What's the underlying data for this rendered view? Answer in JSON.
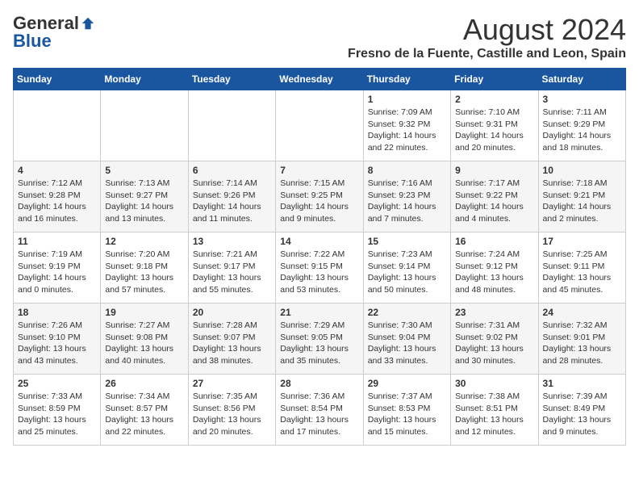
{
  "header": {
    "logo_general": "General",
    "logo_blue": "Blue",
    "month_title": "August 2024",
    "location": "Fresno de la Fuente, Castille and Leon, Spain"
  },
  "weekdays": [
    "Sunday",
    "Monday",
    "Tuesday",
    "Wednesday",
    "Thursday",
    "Friday",
    "Saturday"
  ],
  "weeks": [
    [
      {
        "day": "",
        "sunrise": "",
        "sunset": "",
        "daylight": ""
      },
      {
        "day": "",
        "sunrise": "",
        "sunset": "",
        "daylight": ""
      },
      {
        "day": "",
        "sunrise": "",
        "sunset": "",
        "daylight": ""
      },
      {
        "day": "",
        "sunrise": "",
        "sunset": "",
        "daylight": ""
      },
      {
        "day": "1",
        "sunrise": "Sunrise: 7:09 AM",
        "sunset": "Sunset: 9:32 PM",
        "daylight": "Daylight: 14 hours and 22 minutes."
      },
      {
        "day": "2",
        "sunrise": "Sunrise: 7:10 AM",
        "sunset": "Sunset: 9:31 PM",
        "daylight": "Daylight: 14 hours and 20 minutes."
      },
      {
        "day": "3",
        "sunrise": "Sunrise: 7:11 AM",
        "sunset": "Sunset: 9:29 PM",
        "daylight": "Daylight: 14 hours and 18 minutes."
      }
    ],
    [
      {
        "day": "4",
        "sunrise": "Sunrise: 7:12 AM",
        "sunset": "Sunset: 9:28 PM",
        "daylight": "Daylight: 14 hours and 16 minutes."
      },
      {
        "day": "5",
        "sunrise": "Sunrise: 7:13 AM",
        "sunset": "Sunset: 9:27 PM",
        "daylight": "Daylight: 14 hours and 13 minutes."
      },
      {
        "day": "6",
        "sunrise": "Sunrise: 7:14 AM",
        "sunset": "Sunset: 9:26 PM",
        "daylight": "Daylight: 14 hours and 11 minutes."
      },
      {
        "day": "7",
        "sunrise": "Sunrise: 7:15 AM",
        "sunset": "Sunset: 9:25 PM",
        "daylight": "Daylight: 14 hours and 9 minutes."
      },
      {
        "day": "8",
        "sunrise": "Sunrise: 7:16 AM",
        "sunset": "Sunset: 9:23 PM",
        "daylight": "Daylight: 14 hours and 7 minutes."
      },
      {
        "day": "9",
        "sunrise": "Sunrise: 7:17 AM",
        "sunset": "Sunset: 9:22 PM",
        "daylight": "Daylight: 14 hours and 4 minutes."
      },
      {
        "day": "10",
        "sunrise": "Sunrise: 7:18 AM",
        "sunset": "Sunset: 9:21 PM",
        "daylight": "Daylight: 14 hours and 2 minutes."
      }
    ],
    [
      {
        "day": "11",
        "sunrise": "Sunrise: 7:19 AM",
        "sunset": "Sunset: 9:19 PM",
        "daylight": "Daylight: 14 hours and 0 minutes."
      },
      {
        "day": "12",
        "sunrise": "Sunrise: 7:20 AM",
        "sunset": "Sunset: 9:18 PM",
        "daylight": "Daylight: 13 hours and 57 minutes."
      },
      {
        "day": "13",
        "sunrise": "Sunrise: 7:21 AM",
        "sunset": "Sunset: 9:17 PM",
        "daylight": "Daylight: 13 hours and 55 minutes."
      },
      {
        "day": "14",
        "sunrise": "Sunrise: 7:22 AM",
        "sunset": "Sunset: 9:15 PM",
        "daylight": "Daylight: 13 hours and 53 minutes."
      },
      {
        "day": "15",
        "sunrise": "Sunrise: 7:23 AM",
        "sunset": "Sunset: 9:14 PM",
        "daylight": "Daylight: 13 hours and 50 minutes."
      },
      {
        "day": "16",
        "sunrise": "Sunrise: 7:24 AM",
        "sunset": "Sunset: 9:12 PM",
        "daylight": "Daylight: 13 hours and 48 minutes."
      },
      {
        "day": "17",
        "sunrise": "Sunrise: 7:25 AM",
        "sunset": "Sunset: 9:11 PM",
        "daylight": "Daylight: 13 hours and 45 minutes."
      }
    ],
    [
      {
        "day": "18",
        "sunrise": "Sunrise: 7:26 AM",
        "sunset": "Sunset: 9:10 PM",
        "daylight": "Daylight: 13 hours and 43 minutes."
      },
      {
        "day": "19",
        "sunrise": "Sunrise: 7:27 AM",
        "sunset": "Sunset: 9:08 PM",
        "daylight": "Daylight: 13 hours and 40 minutes."
      },
      {
        "day": "20",
        "sunrise": "Sunrise: 7:28 AM",
        "sunset": "Sunset: 9:07 PM",
        "daylight": "Daylight: 13 hours and 38 minutes."
      },
      {
        "day": "21",
        "sunrise": "Sunrise: 7:29 AM",
        "sunset": "Sunset: 9:05 PM",
        "daylight": "Daylight: 13 hours and 35 minutes."
      },
      {
        "day": "22",
        "sunrise": "Sunrise: 7:30 AM",
        "sunset": "Sunset: 9:04 PM",
        "daylight": "Daylight: 13 hours and 33 minutes."
      },
      {
        "day": "23",
        "sunrise": "Sunrise: 7:31 AM",
        "sunset": "Sunset: 9:02 PM",
        "daylight": "Daylight: 13 hours and 30 minutes."
      },
      {
        "day": "24",
        "sunrise": "Sunrise: 7:32 AM",
        "sunset": "Sunset: 9:01 PM",
        "daylight": "Daylight: 13 hours and 28 minutes."
      }
    ],
    [
      {
        "day": "25",
        "sunrise": "Sunrise: 7:33 AM",
        "sunset": "Sunset: 8:59 PM",
        "daylight": "Daylight: 13 hours and 25 minutes."
      },
      {
        "day": "26",
        "sunrise": "Sunrise: 7:34 AM",
        "sunset": "Sunset: 8:57 PM",
        "daylight": "Daylight: 13 hours and 22 minutes."
      },
      {
        "day": "27",
        "sunrise": "Sunrise: 7:35 AM",
        "sunset": "Sunset: 8:56 PM",
        "daylight": "Daylight: 13 hours and 20 minutes."
      },
      {
        "day": "28",
        "sunrise": "Sunrise: 7:36 AM",
        "sunset": "Sunset: 8:54 PM",
        "daylight": "Daylight: 13 hours and 17 minutes."
      },
      {
        "day": "29",
        "sunrise": "Sunrise: 7:37 AM",
        "sunset": "Sunset: 8:53 PM",
        "daylight": "Daylight: 13 hours and 15 minutes."
      },
      {
        "day": "30",
        "sunrise": "Sunrise: 7:38 AM",
        "sunset": "Sunset: 8:51 PM",
        "daylight": "Daylight: 13 hours and 12 minutes."
      },
      {
        "day": "31",
        "sunrise": "Sunrise: 7:39 AM",
        "sunset": "Sunset: 8:49 PM",
        "daylight": "Daylight: 13 hours and 9 minutes."
      }
    ]
  ]
}
